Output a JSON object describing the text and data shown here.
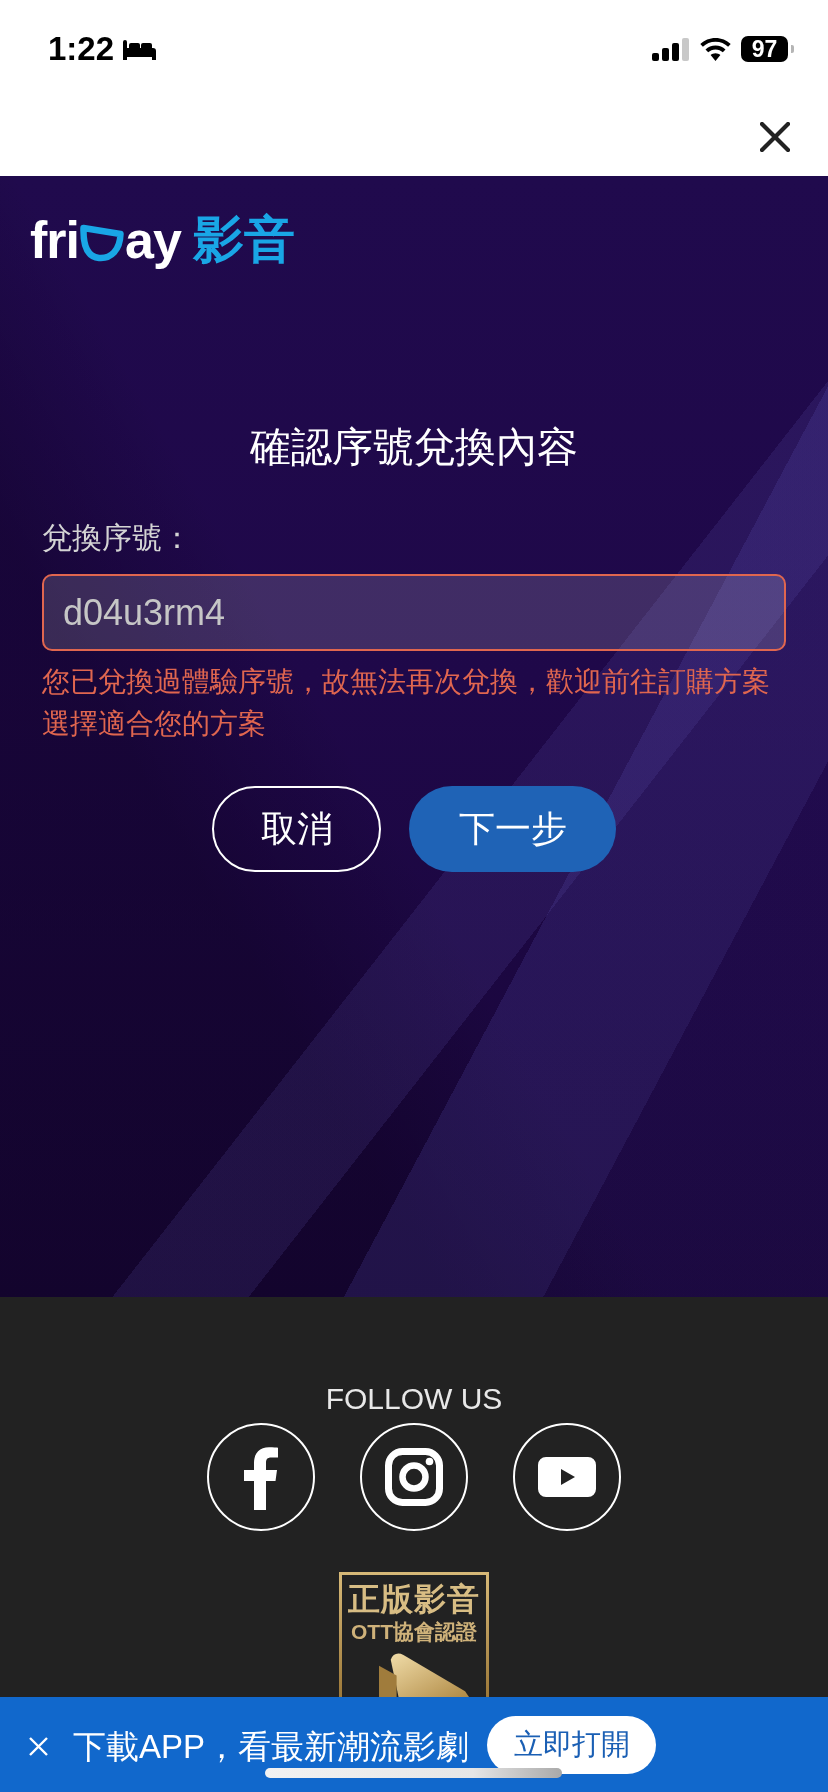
{
  "status_bar": {
    "time": "1:22",
    "battery": "97"
  },
  "logo": {
    "left": "fri",
    "right": "ay",
    "suffix": "影音"
  },
  "redeem": {
    "title": "確認序號兌換內容",
    "field": {
      "label": "兌換序號：",
      "value": "d04u3rm4",
      "invalid": true
    },
    "error": "您已兌換過體驗序號，故無法再次兌換，歡迎前往訂購方案選擇適合您的方案",
    "buttons": [
      {
        "label": "取消",
        "kind": "outline"
      },
      {
        "label": "下一步",
        "kind": "primary"
      }
    ]
  },
  "footer": {
    "follow_label": "FOLLOW US",
    "social": [
      {
        "kind": "facebook"
      },
      {
        "kind": "instagram"
      },
      {
        "kind": "youtube"
      }
    ],
    "badge": {
      "title": "正版影音",
      "subtitle": "OTT協會認證"
    }
  },
  "banner": {
    "text": "下載APP，看最新潮流影劇",
    "button": "立即打開"
  }
}
